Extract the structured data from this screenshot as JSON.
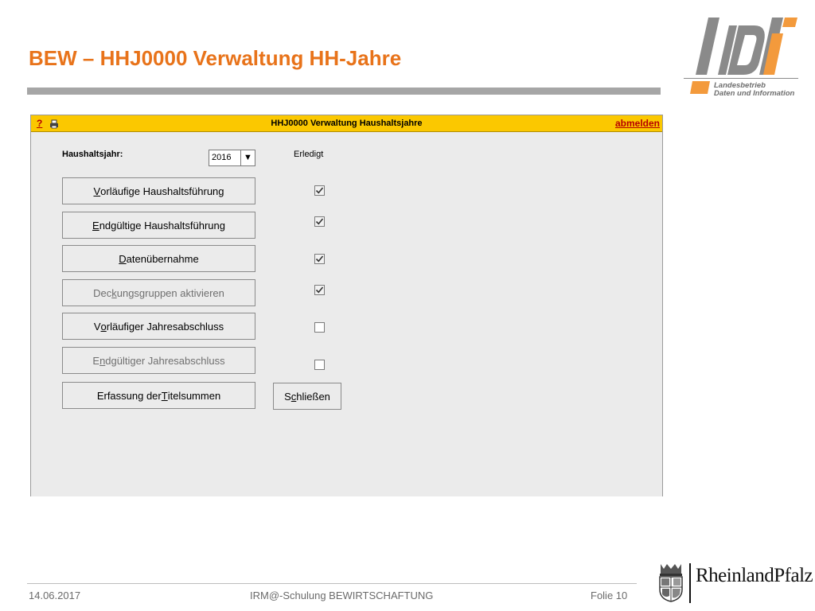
{
  "slide": {
    "title": "BEW – HHJ0000 Verwaltung HH-Jahre",
    "logo_caption_line1": "Landesbetrieb",
    "logo_caption_line2": "Daten und Information"
  },
  "app": {
    "help_label": "?",
    "title": "HHJ0000 Verwaltung Haushaltsjahre",
    "logout_label": "abmelden",
    "year_label": "Haushaltsjahr:",
    "year_value": "2016",
    "done_column_label": "Erledigt",
    "actions": [
      {
        "pre": "",
        "key": "V",
        "post": "orläufige Haushaltsführung",
        "enabled": true,
        "done": true
      },
      {
        "pre": "",
        "key": "E",
        "post": "ndgültige Haushaltsführung",
        "enabled": true,
        "done": true
      },
      {
        "pre": "",
        "key": "D",
        "post": "atenübernahme",
        "enabled": true,
        "done": true
      },
      {
        "pre": "Dec",
        "key": "k",
        "post": "ungsgruppen aktivieren",
        "enabled": false,
        "done": true
      },
      {
        "pre": "V",
        "key": "o",
        "post": "rläufiger Jahresabschluss",
        "enabled": true,
        "done": false
      },
      {
        "pre": "E",
        "key": "n",
        "post": "dgültiger Jahresabschluss",
        "enabled": false,
        "done": false
      },
      {
        "pre": "Erfassung der ",
        "key": "T",
        "post": "itelsummen",
        "enabled": true
      }
    ],
    "close": {
      "pre": "S",
      "key": "c",
      "post": "hließen"
    }
  },
  "footer": {
    "date": "14.06.2017",
    "course": "IRM@-Schulung BEWIRTSCHAFTUNG",
    "page": "Folie 10"
  },
  "branding": {
    "state_logo_text": "RheinlandPfalz"
  },
  "colors": {
    "accent_orange": "#e8731a",
    "titlebar_yellow": "#fbc800",
    "link_red": "#b60000"
  }
}
